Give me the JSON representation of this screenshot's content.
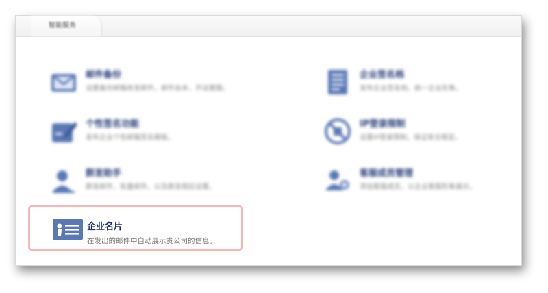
{
  "tab": {
    "label": "智能服务"
  },
  "items": [
    {
      "title": "邮件备份",
      "desc": "设置备份邮箱收发邮件，邮件会本，开设置服。",
      "icon": "mail-backup-icon"
    },
    {
      "title": "企业签名档",
      "desc": "发布企业签名档，统一企业形象。",
      "icon": "signature-doc-icon"
    },
    {
      "title": "个性签名功能",
      "desc": "发布企业个性邮箱签名模板。",
      "icon": "personal-signature-icon"
    },
    {
      "title": "IP登录限制",
      "desc": "设置IP登录限制，保证安全稳定。",
      "icon": "ip-restriction-icon"
    },
    {
      "title": "群发助手",
      "desc": "群发邮件，批量邮件，以及群发相应设置。",
      "icon": "mass-mail-icon"
    },
    {
      "title": "客服成员管理",
      "desc": "添加客服成员，以企业客服形象展示。",
      "icon": "service-staff-icon"
    }
  ],
  "card": {
    "title": "企业名片",
    "desc": "在发出的邮件中自动展示贵公司的信息。",
    "icon": "business-card-icon"
  },
  "colors": {
    "accent": "#1e3263",
    "icon": "#5a78b4",
    "highlight_border": "#f8b6b6"
  }
}
